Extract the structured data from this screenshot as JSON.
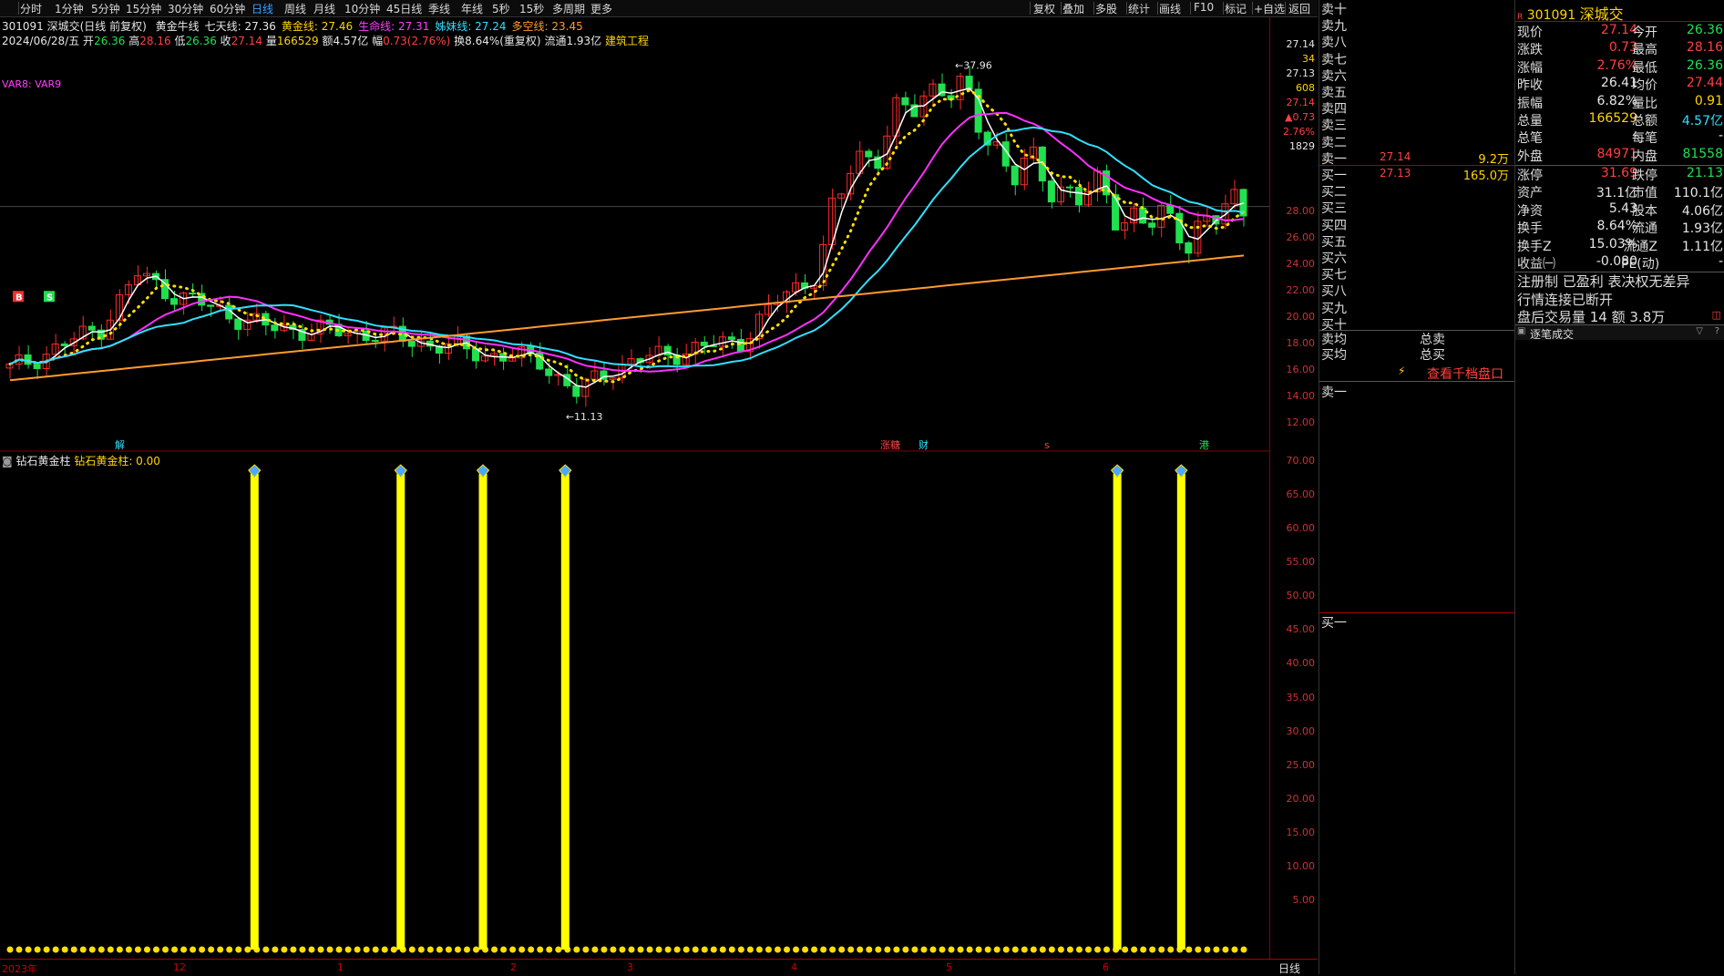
{
  "toolbar": {
    "tabs": [
      "分时",
      "1分钟",
      "5分钟",
      "15分钟",
      "30分钟",
      "60分钟",
      "日线",
      "周线",
      "月线",
      "10分钟",
      "45日线",
      "季线",
      "年线",
      "5秒",
      "15秒",
      "多周期",
      "更多"
    ],
    "active_index": 6,
    "right_buttons": [
      "复权",
      "叠加",
      "多股",
      "统计",
      "画线",
      "F10",
      "标记",
      "+自选",
      "返回"
    ]
  },
  "info": {
    "code_name": "301091 深城交(日线 前复权)",
    "ma_labels": [
      {
        "text": "黄金牛线",
        "color": "#e6e6e6"
      },
      {
        "text": "七天线: 27.36",
        "color": "#e6e6e6"
      },
      {
        "text": "黄金线: 27.46",
        "color": "#ffd400"
      },
      {
        "text": "生命线: 27.31",
        "color": "#ff40ff"
      },
      {
        "text": "姊妹线: 27.24",
        "color": "#30e0ff"
      },
      {
        "text": "多空线: 23.45",
        "color": "#ff9a30"
      }
    ],
    "date": "2024/06/28/五",
    "open_label": "开",
    "open": "26.36",
    "high_label": "高",
    "high": "28.16",
    "low_label": "低",
    "low": "26.36",
    "close_label": "收",
    "close": "27.14",
    "vol_label": "量",
    "vol": "166529",
    "amount": "额4.57亿",
    "change_label": "幅",
    "change": "0.73(2.76%)",
    "turnover": "换8.64%(重复权)",
    "float": "流通1.93亿",
    "industry": "建筑工程",
    "var_label": "VAR8: VAR9"
  },
  "main_axis": {
    "ticks": [
      "28.00",
      "26.00",
      "24.00",
      "22.00",
      "20.00",
      "18.00",
      "16.00",
      "14.00",
      "12.00"
    ],
    "top_labels": [
      {
        "text": "27.14",
        "color": "#e6e6e6"
      },
      {
        "text": "34",
        "color": "#ffd400"
      },
      {
        "text": "27.13",
        "color": "#e6e6e6"
      },
      {
        "text": "608",
        "color": "#ffd400"
      },
      {
        "text": "27.14",
        "color": "#ff4040"
      },
      {
        "text": "▲0.73",
        "color": "#ff4040"
      },
      {
        "text": "2.76%",
        "color": "#ff4040"
      },
      {
        "text": "1829",
        "color": "#e6e6e6"
      }
    ]
  },
  "price_marks": {
    "high": "37.96",
    "low": "11.13"
  },
  "event_badges": [
    {
      "text": "解",
      "color": "#30e0ff"
    },
    {
      "text": "涨糖",
      "color": "#ff4040"
    },
    {
      "text": "财",
      "color": "#30e0ff"
    },
    {
      "text": "s",
      "color": "#ff4040"
    },
    {
      "text": "港",
      "color": "#20e050"
    }
  ],
  "signal_letters": [
    "B",
    "S"
  ],
  "sub": {
    "title": "钻石黄金柱",
    "value_label": "钻石黄金柱: 0.00",
    "ticks": [
      "70.00",
      "65.00",
      "60.00",
      "55.00",
      "50.00",
      "45.00",
      "40.00",
      "35.00",
      "30.00",
      "25.00",
      "20.00",
      "15.00",
      "10.00",
      "5.00"
    ]
  },
  "dates": [
    "2023年",
    "12",
    "1",
    "2",
    "3",
    "4",
    "5",
    "6"
  ],
  "period_label": "日线",
  "orderbook": {
    "sell_levels": [
      "卖十",
      "卖九",
      "卖八",
      "卖七",
      "卖六",
      "卖五",
      "卖四",
      "卖三",
      "卖二",
      "卖一"
    ],
    "sell1_price": "27.14",
    "sell1_vol": "9.2万",
    "buy_levels": [
      "买一",
      "买二",
      "买三",
      "买四",
      "买五",
      "买六",
      "买七",
      "买八",
      "买九",
      "买十"
    ],
    "buy1_price": "27.13",
    "buy1_vol": "165.0万",
    "sell_avg": "卖均",
    "total_sell": "总卖",
    "buy_avg": "买均",
    "total_buy": "总买",
    "view_more": "查看千档盘口",
    "sell_one_label": "卖一",
    "buy_one_label": "买一"
  },
  "quote": {
    "code": "301091",
    "name": "深城交",
    "rows": [
      {
        "l1": "现价",
        "v1": "27.14",
        "c1": "#ff4040",
        "l2": "今开",
        "v2": "26.36",
        "c2": "#20e050"
      },
      {
        "l1": "涨跌",
        "v1": "0.73",
        "c1": "#ff4040",
        "l2": "最高",
        "v2": "28.16",
        "c2": "#ff4040"
      },
      {
        "l1": "涨幅",
        "v1": "2.76%",
        "c1": "#ff4040",
        "l2": "最低",
        "v2": "26.36",
        "c2": "#20e050"
      },
      {
        "l1": "昨收",
        "v1": "26.41",
        "c1": "#e6e6e6",
        "l2": "均价",
        "v2": "27.44",
        "c2": "#ff4040"
      },
      {
        "l1": "振幅",
        "v1": "6.82%",
        "c1": "#e6e6e6",
        "l2": "量比",
        "v2": "0.91",
        "c2": "#ffd400"
      },
      {
        "l1": "总量",
        "v1": "166529",
        "c1": "#ffd400",
        "l2": "总额",
        "v2": "4.57亿",
        "c2": "#30e0ff"
      },
      {
        "l1": "总笔",
        "v1": "-",
        "c1": "#e6e6e6",
        "l2": "每笔",
        "v2": "-",
        "c2": "#e6e6e6"
      },
      {
        "l1": "外盘",
        "v1": "84971",
        "c1": "#ff4040",
        "l2": "内盘",
        "v2": "81558",
        "c2": "#20e050"
      }
    ],
    "rows2": [
      {
        "l1": "涨停",
        "v1": "31.69",
        "c1": "#ff4040",
        "l2": "跌停",
        "v2": "21.13",
        "c2": "#20e050"
      },
      {
        "l1": "资产",
        "v1": "31.1亿",
        "c1": "#e6e6e6",
        "l2": "市值",
        "v2": "110.1亿",
        "c2": "#e6e6e6"
      },
      {
        "l1": "净资",
        "v1": "5.43",
        "c1": "#e6e6e6",
        "l2": "股本",
        "v2": "4.06亿",
        "c2": "#e6e6e6"
      },
      {
        "l1": "换手",
        "v1": "8.64%",
        "c1": "#e6e6e6",
        "l2": "流通",
        "v2": "1.93亿",
        "c2": "#e6e6e6"
      },
      {
        "l1": "换手Z",
        "v1": "15.03%",
        "c1": "#e6e6e6",
        "l2": "流通Z",
        "v2": "1.11亿",
        "c2": "#e6e6e6"
      },
      {
        "l1": "收益㈠",
        "v1": "-0.080",
        "c1": "#e6e6e6",
        "l2": "PE(动)",
        "v2": "-",
        "c2": "#e6e6e6"
      }
    ],
    "note1": "注册制 已盈利 表决权无差异",
    "note2": "行情连接已断开",
    "after_hours": "盘后交易量 14 额 3.8万",
    "trade_panel": "逐笔成交"
  }
}
